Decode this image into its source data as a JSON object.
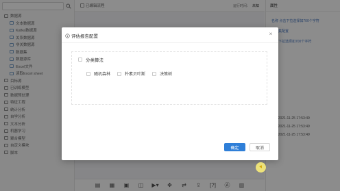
{
  "sidebar": {
    "search_placeholder": "",
    "items": [
      {
        "label": "数据源",
        "level": 0
      },
      {
        "label": "文本数据源",
        "level": 1
      },
      {
        "label": "Kafka数据源",
        "level": 1
      },
      {
        "label": "关系数据源",
        "level": 1
      },
      {
        "label": "非关数据源",
        "level": 1
      },
      {
        "label": "数据集",
        "level": 1
      },
      {
        "label": "数据源库",
        "level": 1
      },
      {
        "label": "Excel文件",
        "level": 1
      },
      {
        "label": "读取Excel sheet",
        "level": 1
      },
      {
        "label": "目标源",
        "level": 0
      },
      {
        "label": "已训练模型",
        "level": 0
      },
      {
        "label": "数据预处理",
        "level": 0
      },
      {
        "label": "特征工程",
        "level": 0
      },
      {
        "label": "统计分析",
        "level": 0
      },
      {
        "label": "自学分析",
        "level": 0
      },
      {
        "label": "文本分析",
        "level": 0
      },
      {
        "label": "机器学习",
        "level": 0
      },
      {
        "label": "聚合模型",
        "level": 0
      },
      {
        "label": "自定义模块",
        "level": 0
      },
      {
        "label": "脚本",
        "level": 0
      }
    ]
  },
  "main": {
    "tab_label": "已编辑流程",
    "run_label": "运行时间：",
    "run_value": "未知",
    "toolbar_icons": [
      "list-icon",
      "grid-icon",
      "image-icon",
      "mirror-icon",
      "play-dropdown-icon",
      "move-icon",
      "swap-icon",
      "export-icon",
      "bracket-icon",
      "at-icon",
      "document-icon"
    ],
    "toolbar_glyphs": [
      "▤",
      "▦",
      "▣",
      "◫",
      "▶▾",
      "✥",
      "⇄",
      "⇪",
      "[?]",
      "Ⓐ",
      "▥"
    ]
  },
  "right_panel": {
    "title": "属性",
    "line1": "名称 点击下拉选择如700个字符",
    "line2": "数据集配置",
    "line3": "点击下拉选择如700个字符",
    "times": [
      "095 2021-11-25 17:53:49",
      "095 2021-11-25 17:53:49",
      "095 2021-11-25 17:53:49"
    ]
  },
  "modal": {
    "title": "评估报告配置",
    "close_glyph": "×",
    "group_label": "分类算法",
    "options": [
      "随机森林",
      "朴素贝叶斯",
      "决策树"
    ],
    "ok_label": "确定",
    "cancel_label": "取消"
  },
  "colors": {
    "primary": "#2f7fd8",
    "overlay": "rgba(0,0,0,0.45)",
    "cursor_highlight": "#fff278"
  }
}
